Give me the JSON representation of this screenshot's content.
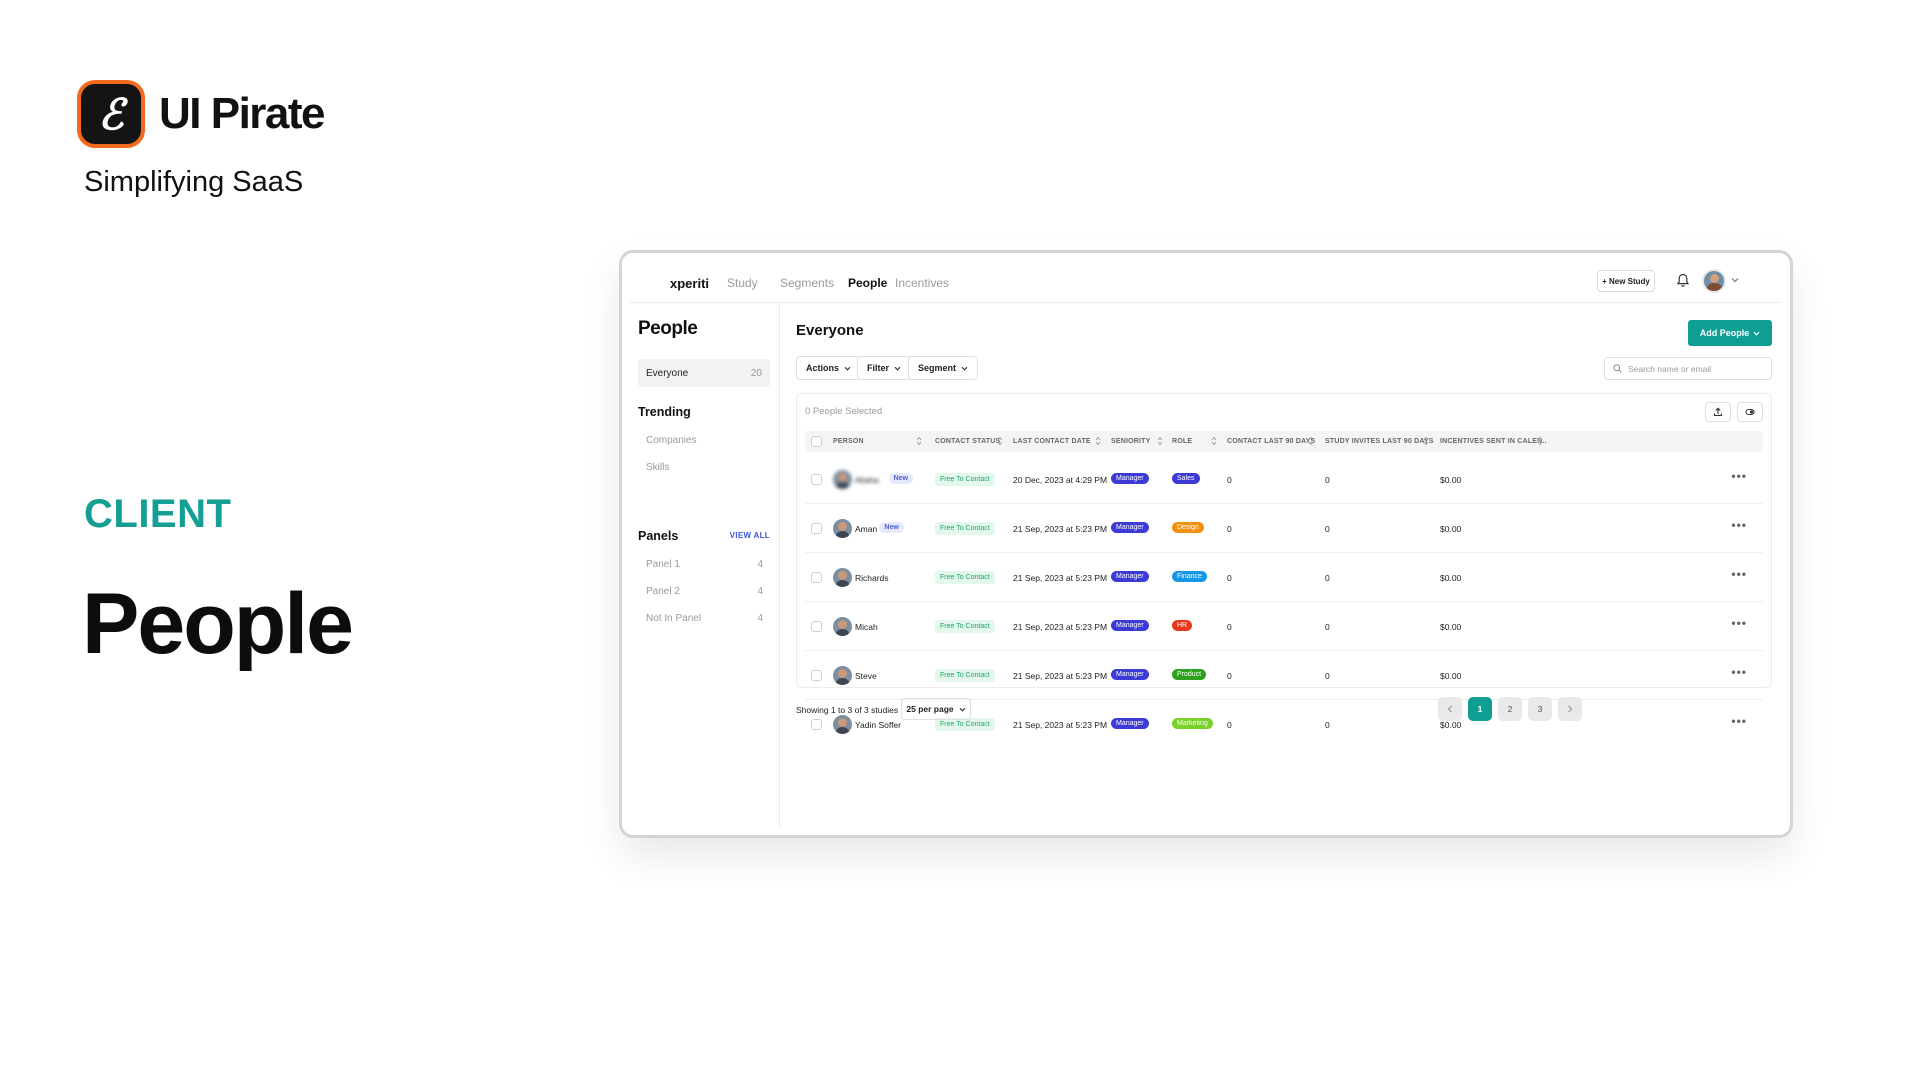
{
  "brand": {
    "name": "UI Pirate",
    "tagline": "Simplifying SaaS",
    "accent": "#f26a1b"
  },
  "section_label": "CLIENT",
  "page_heading": "People",
  "app": {
    "logo": "xperiti",
    "nav": [
      "Study",
      "Segments",
      "People",
      "Incentives"
    ],
    "active_nav": "People",
    "new_study_label": "+ New Study",
    "sidebar": {
      "title": "People",
      "everyone": {
        "label": "Everyone",
        "count": "20"
      },
      "trending_heading": "Trending",
      "trending_items": [
        "Companies",
        "Skills"
      ],
      "panels_heading": "Panels",
      "view_all": "VIEW ALL",
      "panels": [
        {
          "label": "Panel 1",
          "count": "4"
        },
        {
          "label": "Panel 2",
          "count": "4"
        },
        {
          "label": "Not In Panel",
          "count": "4"
        }
      ]
    },
    "main": {
      "title": "Everyone",
      "add_people_label": "Add People",
      "toolbar": {
        "actions": "Actions",
        "filter": "Filter",
        "segment": "Segment"
      },
      "search_placeholder": "Search name or email",
      "selected_text": "0 People Selected",
      "columns": [
        "PERSON",
        "CONTACT STATUS",
        "LAST CONTACT DATE",
        "SENIORITY",
        "ROLE",
        "CONTACT LAST 90 DAYS",
        "STUDY INVITES LAST 90 DAYS",
        "INCENTIVES SENT IN CALEN.."
      ],
      "rows": [
        {
          "name": "Aliaha",
          "is_new": true,
          "new_label": "New",
          "status": "Free To Contact",
          "last_contact": "20 Dec, 2023 at 4:29 PM",
          "seniority": "Manager",
          "role": "Sales",
          "role_color": "#3d3bd6",
          "contact_90": "0",
          "invites_90": "0",
          "incentives": "$0.00"
        },
        {
          "name": "Aman",
          "is_new": true,
          "new_label": "New",
          "status": "Free To Contact",
          "last_contact": "21 Sep, 2023 at 5:23 PM",
          "seniority": "Manager",
          "role": "Design",
          "role_color": "#f0900f",
          "contact_90": "0",
          "invites_90": "0",
          "incentives": "$0.00"
        },
        {
          "name": "Richards",
          "is_new": false,
          "new_label": "",
          "status": "Free To Contact",
          "last_contact": "21 Sep, 2023 at 5:23 PM",
          "seniority": "Manager",
          "role": "Finance",
          "role_color": "#1696e6",
          "contact_90": "0",
          "invites_90": "0",
          "incentives": "$0.00"
        },
        {
          "name": "Micah",
          "is_new": false,
          "new_label": "",
          "status": "Free To Contact",
          "last_contact": "21 Sep, 2023 at 5:23 PM",
          "seniority": "Manager",
          "role": "HR",
          "role_color": "#e8391e",
          "contact_90": "0",
          "invites_90": "0",
          "incentives": "$0.00"
        },
        {
          "name": "Steve",
          "is_new": false,
          "new_label": "",
          "status": "Free To Contact",
          "last_contact": "21 Sep, 2023 at 5:23 PM",
          "seniority": "Manager",
          "role": "Product",
          "role_color": "#2aa31b",
          "contact_90": "0",
          "invites_90": "0",
          "incentives": "$0.00"
        },
        {
          "name": "Yadin Soffer",
          "is_new": false,
          "new_label": "",
          "status": "Free To Contact",
          "last_contact": "21 Sep, 2023 at 5:23 PM",
          "seniority": "Manager",
          "role": "Marketing",
          "role_color": "#7ad12a",
          "contact_90": "0",
          "invites_90": "0",
          "incentives": "$0.00"
        }
      ],
      "footer": {
        "showing": "Showing 1 to 3 of 3 studies",
        "per_page": "25 per page",
        "pages": [
          "1",
          "2",
          "3"
        ],
        "active_page": "1"
      }
    }
  }
}
